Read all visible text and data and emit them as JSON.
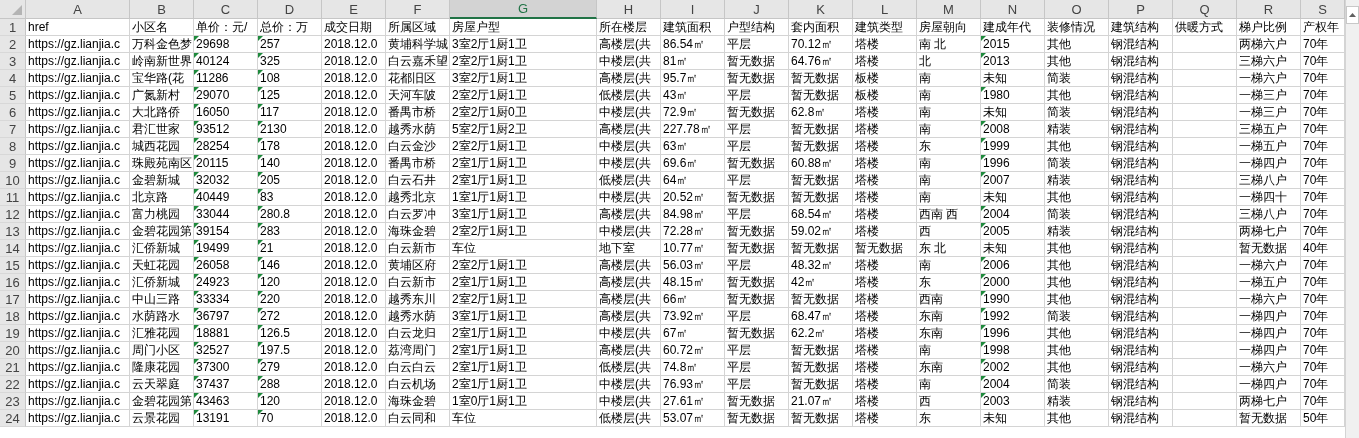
{
  "columns": [
    {
      "label": "A",
      "selected": false
    },
    {
      "label": "B",
      "selected": false
    },
    {
      "label": "C",
      "selected": false
    },
    {
      "label": "D",
      "selected": false
    },
    {
      "label": "E",
      "selected": false
    },
    {
      "label": "F",
      "selected": false
    },
    {
      "label": "G",
      "selected": true
    },
    {
      "label": "H",
      "selected": false
    },
    {
      "label": "I",
      "selected": false
    },
    {
      "label": "J",
      "selected": false
    },
    {
      "label": "K",
      "selected": false
    },
    {
      "label": "L",
      "selected": false
    },
    {
      "label": "M",
      "selected": false
    },
    {
      "label": "N",
      "selected": false
    },
    {
      "label": "O",
      "selected": false
    },
    {
      "label": "P",
      "selected": false
    },
    {
      "label": "Q",
      "selected": false
    },
    {
      "label": "R",
      "selected": false
    },
    {
      "label": "S",
      "selected": false
    }
  ],
  "rows": [
    {
      "number": "1",
      "cells": [
        "href",
        "小区名",
        "单价：元/",
        "总价：万",
        "成交日期",
        "所属区域",
        "房屋户型",
        "所在楼层",
        "建筑面积",
        "户型结构",
        "套内面积",
        "建筑类型",
        "房屋朝向",
        "建成年代",
        "装修情况",
        "建筑结构",
        "供暖方式",
        "梯户比例",
        "产权年"
      ]
    },
    {
      "number": "2",
      "cells": [
        "https://gz.lianjia.c",
        "万科金色梦",
        {
          "text": "29698",
          "flagged": true
        },
        {
          "text": "257",
          "flagged": true
        },
        "2018.12.0",
        "黄埔科学城",
        "3室2厅1厨1卫",
        "高楼层(共",
        "86.54㎡",
        "平层",
        "70.12㎡",
        "塔楼",
        "南 北",
        {
          "text": "2015",
          "flagged": true
        },
        "其他",
        "钢混结构",
        null,
        "两梯六户",
        "70年"
      ]
    },
    {
      "number": "3",
      "cells": [
        "https://gz.lianjia.c",
        "岭南新世界",
        {
          "text": "40124",
          "flagged": true
        },
        {
          "text": "325",
          "flagged": true
        },
        "2018.12.0",
        "白云嘉禾望",
        "2室2厅1厨1卫",
        "中楼层(共",
        "81㎡",
        "暂无数据",
        "64.76㎡",
        "塔楼",
        "北",
        {
          "text": "2013",
          "flagged": true
        },
        "其他",
        "钢混结构",
        null,
        "三梯六户",
        "70年"
      ]
    },
    {
      "number": "4",
      "cells": [
        "https://gz.lianjia.c",
        "宝华路(花",
        {
          "text": "11286",
          "flagged": true
        },
        {
          "text": "108",
          "flagged": true
        },
        "2018.12.0",
        "花都旧区",
        "3室2厅1厨1卫",
        "高楼层(共",
        "95.7㎡",
        "暂无数据",
        "暂无数据",
        "板楼",
        "南",
        "未知",
        "简装",
        "钢混结构",
        null,
        "一梯六户",
        "70年"
      ]
    },
    {
      "number": "5",
      "cells": [
        "https://gz.lianjia.c",
        "广氮新村",
        {
          "text": "29070",
          "flagged": true
        },
        {
          "text": "125",
          "flagged": true
        },
        "2018.12.0",
        "天河车陂",
        "2室2厅1厨1卫",
        "低楼层(共",
        "43㎡",
        "平层",
        "暂无数据",
        "板楼",
        "南",
        {
          "text": "1980",
          "flagged": true
        },
        "其他",
        "钢混结构",
        null,
        "一梯三户",
        "70年"
      ]
    },
    {
      "number": "6",
      "cells": [
        "https://gz.lianjia.c",
        "大北路侨",
        {
          "text": "16050",
          "flagged": true
        },
        {
          "text": "117",
          "flagged": true
        },
        "2018.12.0",
        "番禺市桥",
        "2室2厅1厨0卫",
        "中楼层(共",
        "72.9㎡",
        "暂无数据",
        "62.8㎡",
        "塔楼",
        "南",
        "未知",
        "简装",
        "钢混结构",
        null,
        "一梯三户",
        "70年"
      ]
    },
    {
      "number": "7",
      "cells": [
        "https://gz.lianjia.c",
        "君汇世家",
        {
          "text": "93512",
          "flagged": true
        },
        {
          "text": "2130",
          "flagged": true
        },
        "2018.12.0",
        "越秀水荫",
        "5室2厅1厨2卫",
        "高楼层(共",
        "227.78㎡",
        "平层",
        "暂无数据",
        "塔楼",
        "南",
        {
          "text": "2008",
          "flagged": true
        },
        "精装",
        "钢混结构",
        null,
        "三梯五户",
        "70年"
      ]
    },
    {
      "number": "8",
      "cells": [
        "https://gz.lianjia.c",
        "城西花园",
        {
          "text": "28254",
          "flagged": true
        },
        {
          "text": "178",
          "flagged": true
        },
        "2018.12.0",
        "白云金沙",
        "2室2厅1厨1卫",
        "中楼层(共",
        "63㎡",
        "平层",
        "暂无数据",
        "塔楼",
        "东",
        {
          "text": "1999",
          "flagged": true
        },
        "其他",
        "钢混结构",
        null,
        "一梯五户",
        "70年"
      ]
    },
    {
      "number": "9",
      "cells": [
        "https://gz.lianjia.c",
        "珠殿苑南区",
        {
          "text": "20115",
          "flagged": true
        },
        {
          "text": "140",
          "flagged": true
        },
        "2018.12.0",
        "番禺市桥",
        "2室1厅1厨1卫",
        "中楼层(共",
        "69.6㎡",
        "暂无数据",
        "60.88㎡",
        "塔楼",
        "南",
        {
          "text": "1996",
          "flagged": true
        },
        "简装",
        "钢混结构",
        null,
        "一梯四户",
        "70年"
      ]
    },
    {
      "number": "10",
      "cells": [
        "https://gz.lianjia.c",
        "金碧新城",
        {
          "text": "32032",
          "flagged": true
        },
        {
          "text": "205",
          "flagged": true
        },
        "2018.12.0",
        "白云石井",
        "2室1厅1厨1卫",
        "低楼层(共",
        "64㎡",
        "平层",
        "暂无数据",
        "塔楼",
        "南",
        {
          "text": "2007",
          "flagged": true
        },
        "精装",
        "钢混结构",
        null,
        "三梯八户",
        "70年"
      ]
    },
    {
      "number": "11",
      "cells": [
        "https://gz.lianjia.c",
        "北京路",
        {
          "text": "40449",
          "flagged": true
        },
        {
          "text": "83",
          "flagged": true
        },
        "2018.12.0",
        "越秀北京",
        "1室1厅1厨1卫",
        "中楼层(共",
        "20.52㎡",
        "暂无数据",
        "暂无数据",
        "塔楼",
        "南",
        "未知",
        "其他",
        "钢混结构",
        null,
        "一梯四十",
        "70年"
      ]
    },
    {
      "number": "12",
      "cells": [
        "https://gz.lianjia.c",
        "富力桃园",
        {
          "text": "33044",
          "flagged": true
        },
        {
          "text": "280.8",
          "flagged": true
        },
        "2018.12.0",
        "白云罗冲",
        "3室1厅1厨1卫",
        "高楼层(共",
        "84.98㎡",
        "平层",
        "68.54㎡",
        "塔楼",
        "西南 西",
        {
          "text": "2004",
          "flagged": true
        },
        "简装",
        "钢混结构",
        null,
        "三梯八户",
        "70年"
      ]
    },
    {
      "number": "13",
      "cells": [
        "https://gz.lianjia.c",
        "金碧花园第",
        {
          "text": "39154",
          "flagged": true
        },
        {
          "text": "283",
          "flagged": true
        },
        "2018.12.0",
        "海珠金碧",
        "2室2厅1厨1卫",
        "中楼层(共",
        "72.28㎡",
        "暂无数据",
        "59.02㎡",
        "塔楼",
        "西",
        {
          "text": "2005",
          "flagged": true
        },
        "精装",
        "钢混结构",
        null,
        "两梯七户",
        "70年"
      ]
    },
    {
      "number": "14",
      "cells": [
        "https://gz.lianjia.c",
        "汇侨新城",
        {
          "text": "19499",
          "flagged": true
        },
        {
          "text": "21",
          "flagged": true
        },
        "2018.12.0",
        "白云新市",
        "车位",
        "地下室",
        "10.77㎡",
        "暂无数据",
        "暂无数据",
        "暂无数据",
        "东 北",
        "未知",
        "其他",
        "钢混结构",
        null,
        "暂无数据",
        "40年"
      ]
    },
    {
      "number": "15",
      "cells": [
        "https://gz.lianjia.c",
        "天虹花园",
        {
          "text": "26058",
          "flagged": true
        },
        {
          "text": "146",
          "flagged": true
        },
        "2018.12.0",
        "黄埔区府",
        "2室2厅1厨1卫",
        "高楼层(共",
        "56.03㎡",
        "平层",
        "48.32㎡",
        "塔楼",
        "南",
        {
          "text": "2006",
          "flagged": true
        },
        "其他",
        "钢混结构",
        null,
        "一梯六户",
        "70年"
      ]
    },
    {
      "number": "16",
      "cells": [
        "https://gz.lianjia.c",
        "汇侨新城",
        {
          "text": "24923",
          "flagged": true
        },
        {
          "text": "120",
          "flagged": true
        },
        "2018.12.0",
        "白云新市",
        "2室1厅1厨1卫",
        "高楼层(共",
        "48.15㎡",
        "暂无数据",
        "42㎡",
        "塔楼",
        "东",
        {
          "text": "2000",
          "flagged": true
        },
        "其他",
        "钢混结构",
        null,
        "一梯五户",
        "70年"
      ]
    },
    {
      "number": "17",
      "cells": [
        "https://gz.lianjia.c",
        "中山三路",
        {
          "text": "33334",
          "flagged": true
        },
        {
          "text": "220",
          "flagged": true
        },
        "2018.12.0",
        "越秀东川",
        "2室2厅1厨1卫",
        "高楼层(共",
        "66㎡",
        "暂无数据",
        "暂无数据",
        "塔楼",
        "西南",
        {
          "text": "1990",
          "flagged": true
        },
        "其他",
        "钢混结构",
        null,
        "一梯六户",
        "70年"
      ]
    },
    {
      "number": "18",
      "cells": [
        "https://gz.lianjia.c",
        "水荫路水",
        {
          "text": "36797",
          "flagged": true
        },
        {
          "text": "272",
          "flagged": true
        },
        "2018.12.0",
        "越秀水荫",
        "3室1厅1厨1卫",
        "高楼层(共",
        "73.92㎡",
        "平层",
        "68.47㎡",
        "塔楼",
        "东南",
        {
          "text": "1992",
          "flagged": true
        },
        "简装",
        "钢混结构",
        null,
        "一梯四户",
        "70年"
      ]
    },
    {
      "number": "19",
      "cells": [
        "https://gz.lianjia.c",
        "汇雅花园",
        {
          "text": "18881",
          "flagged": true
        },
        {
          "text": "126.5",
          "flagged": true
        },
        "2018.12.0",
        "白云龙归",
        "2室1厅1厨1卫",
        "中楼层(共",
        "67㎡",
        "暂无数据",
        "62.2㎡",
        "塔楼",
        "东南",
        {
          "text": "1996",
          "flagged": true
        },
        "其他",
        "钢混结构",
        null,
        "一梯四户",
        "70年"
      ]
    },
    {
      "number": "20",
      "cells": [
        "https://gz.lianjia.c",
        "周门小区",
        {
          "text": "32527",
          "flagged": true
        },
        {
          "text": "197.5",
          "flagged": true
        },
        "2018.12.0",
        "荔湾周门",
        "2室1厅1厨1卫",
        "高楼层(共",
        "60.72㎡",
        "平层",
        "暂无数据",
        "塔楼",
        "南",
        {
          "text": "1998",
          "flagged": true
        },
        "其他",
        "钢混结构",
        null,
        "一梯四户",
        "70年"
      ]
    },
    {
      "number": "21",
      "cells": [
        "https://gz.lianjia.c",
        "隆康花园",
        {
          "text": "37300",
          "flagged": true
        },
        {
          "text": "279",
          "flagged": true
        },
        "2018.12.0",
        "白云白云",
        "2室1厅1厨1卫",
        "低楼层(共",
        "74.8㎡",
        "平层",
        "暂无数据",
        "塔楼",
        "东南",
        {
          "text": "2002",
          "flagged": true
        },
        "其他",
        "钢混结构",
        null,
        "一梯六户",
        "70年"
      ]
    },
    {
      "number": "22",
      "cells": [
        "https://gz.lianjia.c",
        "云天翠庭",
        {
          "text": "37437",
          "flagged": true
        },
        {
          "text": "288",
          "flagged": true
        },
        "2018.12.0",
        "白云机场",
        "2室1厅1厨1卫",
        "中楼层(共",
        "76.93㎡",
        "平层",
        "暂无数据",
        "塔楼",
        "南",
        {
          "text": "2004",
          "flagged": true
        },
        "简装",
        "钢混结构",
        null,
        "一梯四户",
        "70年"
      ]
    },
    {
      "number": "23",
      "cells": [
        "https://gz.lianjia.c",
        "金碧花园第",
        {
          "text": "43463",
          "flagged": true
        },
        {
          "text": "120",
          "flagged": true
        },
        "2018.12.0",
        "海珠金碧",
        "1室0厅1厨1卫",
        "中楼层(共",
        "27.61㎡",
        "暂无数据",
        "21.07㎡",
        "塔楼",
        "西",
        {
          "text": "2003",
          "flagged": true
        },
        "精装",
        "钢混结构",
        null,
        "两梯七户",
        "70年"
      ]
    },
    {
      "number": "24",
      "cells": [
        "https://gz.lianjia.c",
        "云景花园",
        {
          "text": "13191",
          "flagged": true
        },
        {
          "text": "70",
          "flagged": true
        },
        "2018.12.0",
        "白云同和",
        "车位",
        "低楼层(共",
        "53.07㎡",
        "暂无数据",
        "暂无数据",
        "塔楼",
        "东",
        "未知",
        "其他",
        "钢混结构",
        null,
        "暂无数据",
        "50年"
      ]
    }
  ]
}
